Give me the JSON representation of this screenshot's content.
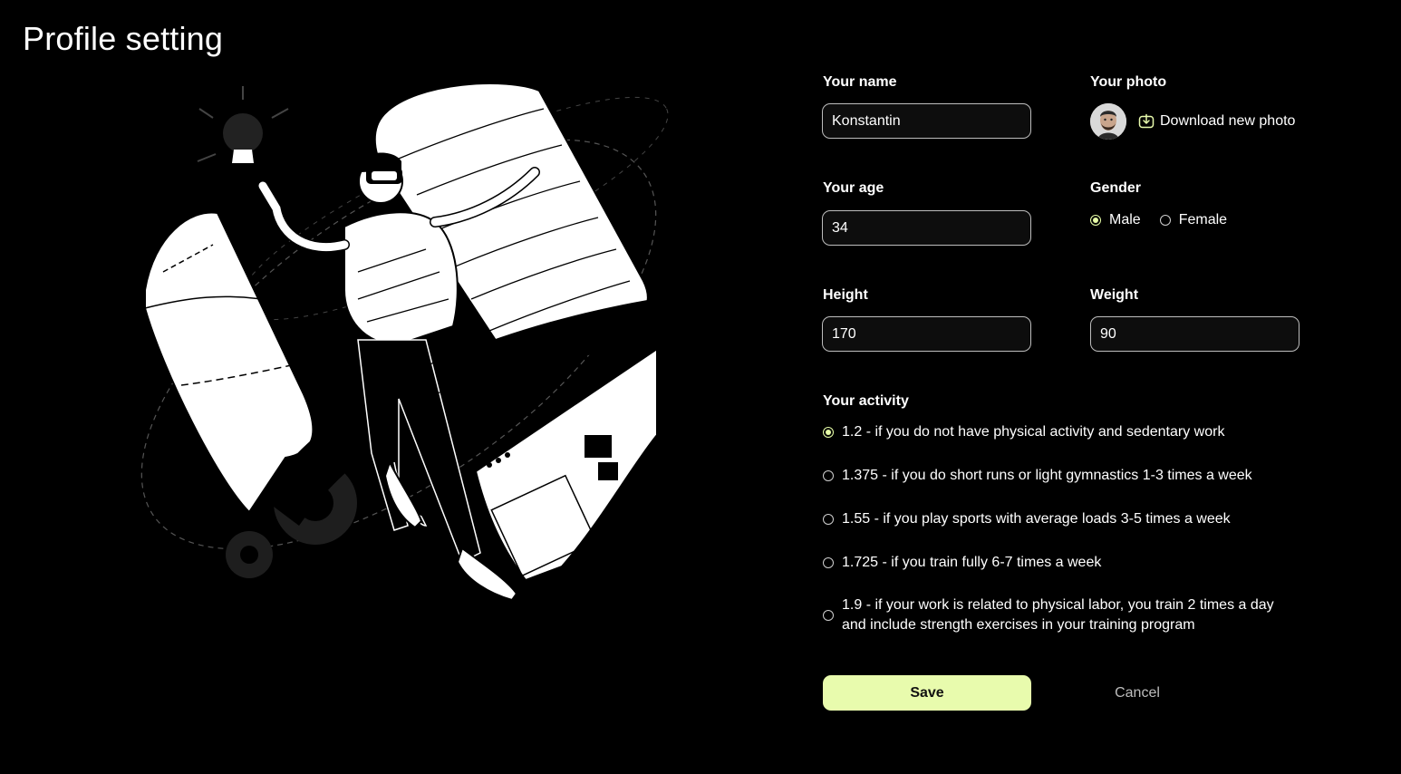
{
  "page": {
    "title": "Profile setting"
  },
  "form": {
    "name": {
      "label": "Your name",
      "value": "Konstantin"
    },
    "photo": {
      "label": "Your photo",
      "download_label": "Download new photo"
    },
    "age": {
      "label": "Your age",
      "value": "34"
    },
    "gender": {
      "label": "Gender",
      "options": [
        {
          "label": "Male",
          "selected": true
        },
        {
          "label": "Female",
          "selected": false
        }
      ]
    },
    "height": {
      "label": "Height",
      "value": "170"
    },
    "weight": {
      "label": "Weight",
      "value": "90"
    },
    "activity": {
      "label": "Your activity",
      "options": [
        {
          "label": "1.2 - if you do not have physical activity and sedentary work",
          "selected": true
        },
        {
          "label": "1.375 - if you do short runs or light gymnastics 1-3 times a week",
          "selected": false
        },
        {
          "label": "1.55 - if you play sports with average loads 3-5 times a week",
          "selected": false
        },
        {
          "label": "1.725 - if you train fully 6-7 times a week",
          "selected": false
        },
        {
          "label": "1.9 - if your work is related to physical labor, you train 2 times a day and include strength exercises in your training program",
          "selected": false
        }
      ]
    }
  },
  "actions": {
    "save_label": "Save",
    "cancel_label": "Cancel"
  },
  "colors": {
    "accent": "#e8fbad",
    "background": "#000000",
    "field_border": "#bdbdbd"
  },
  "icons": {
    "download": "download-photo-icon",
    "avatar": "user-avatar"
  }
}
